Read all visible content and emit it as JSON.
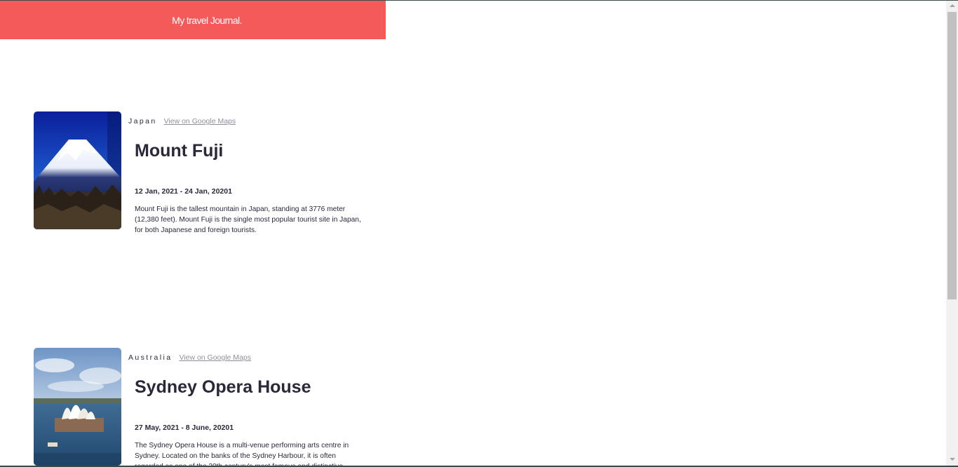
{
  "navbar": {
    "title": "My travel Journal."
  },
  "entries": [
    {
      "country": "Japan",
      "maps_link": "View on Google Maps",
      "title": "Mount Fuji",
      "dates": "12 Jan, 2021 - 24 Jan, 20201",
      "description": "Mount Fuji is the tallest mountain in Japan, standing at 3776 meter (12,380 feet). Mount Fuji is the single most popular tourist site in Japan, for both Japanese and foreign tourists."
    },
    {
      "country": "Australia",
      "maps_link": "View on Google Maps",
      "title": "Sydney Opera House",
      "dates": "27 May, 2021 - 8 June, 20201",
      "description": "The Sydney Opera House is a multi-venue performing arts centre in Sydney. Located on the banks of the Sydney Harbour, it is often regarded as one of the 20th century's most famous and distinctive buildings."
    }
  ],
  "colors": {
    "navbar": "#f55a5a",
    "text": "#2b283a",
    "link": "#918e9b"
  }
}
